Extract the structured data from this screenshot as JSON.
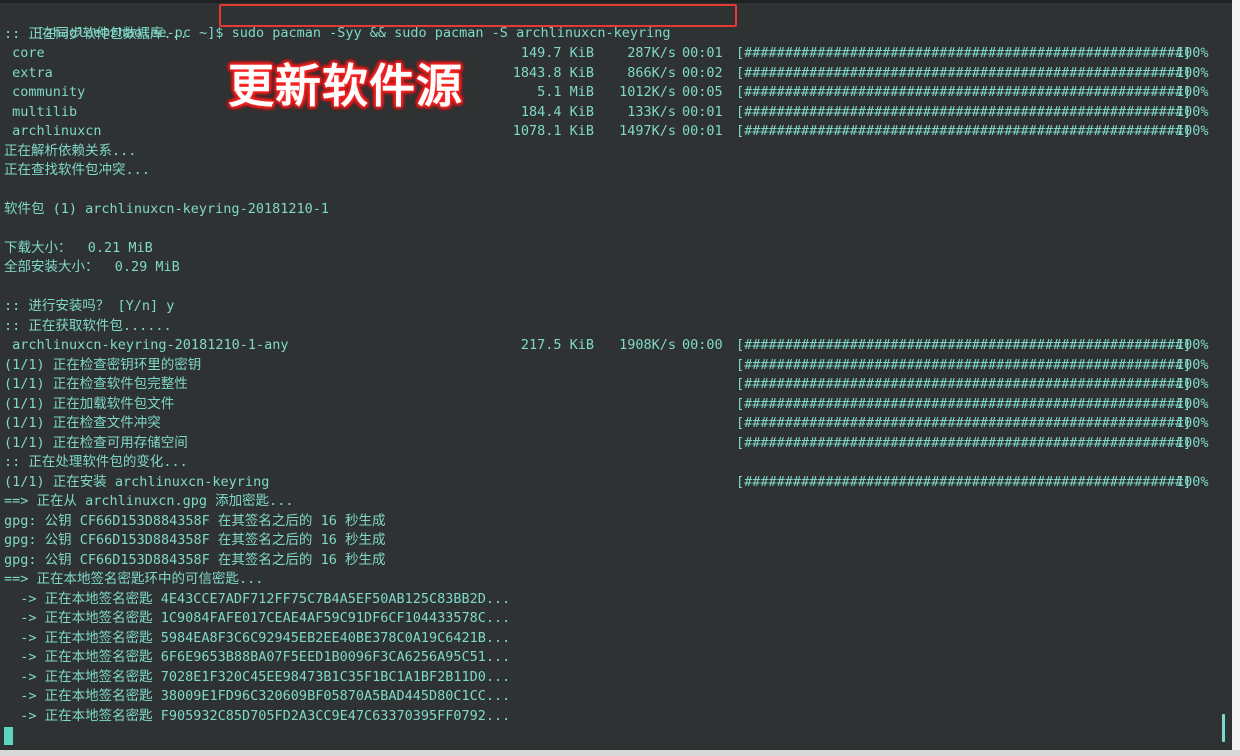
{
  "terminal": {
    "prompt": "[zhaolee@zhaolee-pc ~]$ ",
    "command": "sudo pacman -Syy && sudo pacman -S archlinuxcn-keyring",
    "sync_msg": ":: 正在同步软件包数据库...",
    "repos": [
      {
        "name": " core",
        "size": "149.7 KiB",
        "speed": "287K/s",
        "time": "00:01",
        "bar": "[######################################################]",
        "pct": "100%"
      },
      {
        "name": " extra",
        "size": "1843.8 KiB",
        "speed": "866K/s",
        "time": "00:02",
        "bar": "[######################################################]",
        "pct": "100%"
      },
      {
        "name": " community",
        "size": "5.1 MiB",
        "speed": "1012K/s",
        "time": "00:05",
        "bar": "[######################################################]",
        "pct": "100%"
      },
      {
        "name": " multilib",
        "size": "184.4 KiB",
        "speed": "133K/s",
        "time": "00:01",
        "bar": "[######################################################]",
        "pct": "100%"
      },
      {
        "name": " archlinuxcn",
        "size": "1078.1 KiB",
        "speed": "1497K/s",
        "time": "00:01",
        "bar": "[######################################################]",
        "pct": "100%"
      }
    ],
    "resolving": "正在解析依赖关系...",
    "conflicts": "正在查找软件包冲突...",
    "package_line": "软件包 (1) archlinuxcn-keyring-20181210-1",
    "download_size": "下载大小：  0.21 MiB",
    "install_size": "全部安装大小：  0.29 MiB",
    "confirm": ":: 进行安装吗？ [Y/n] y",
    "fetching": ":: 正在获取软件包......",
    "fetch": {
      "name": " archlinuxcn-keyring-20181210-1-any",
      "size": "217.5 KiB",
      "speed": "1908K/s",
      "time": "00:00",
      "bar": "[######################################################]",
      "pct": "100%"
    },
    "checks": [
      {
        "text": "(1/1) 正在检查密钥环里的密钥",
        "bar": "[######################################################]",
        "pct": "100%"
      },
      {
        "text": "(1/1) 正在检查软件包完整性",
        "bar": "[######################################################]",
        "pct": "100%"
      },
      {
        "text": "(1/1) 正在加载软件包文件",
        "bar": "[######################################################]",
        "pct": "100%"
      },
      {
        "text": "(1/1) 正在检查文件冲突",
        "bar": "[######################################################]",
        "pct": "100%"
      },
      {
        "text": "(1/1) 正在检查可用存储空间",
        "bar": "[######################################################]",
        "pct": "100%"
      }
    ],
    "processing": ":: 正在处理软件包的变化...",
    "installing": {
      "text": "(1/1) 正在安装 archlinuxcn-keyring",
      "bar": "[######################################################]",
      "pct": "100%"
    },
    "adding_keys": "==> 正在从 archlinuxcn.gpg 添加密匙...",
    "gpg_lines": [
      "gpg: 公钥 CF66D153D884358F 在其签名之后的 16 秒生成",
      "gpg: 公钥 CF66D153D884358F 在其签名之后的 16 秒生成",
      "gpg: 公钥 CF66D153D884358F 在其签名之后的 16 秒生成"
    ],
    "local_sign": "==> 正在本地签名密匙环中的可信密匙...",
    "sign_lines": [
      "  -> 正在本地签名密匙 4E43CCE7ADF712FF75C7B4A5EF50AB125C83BB2D...",
      "  -> 正在本地签名密匙 1C9084FAFE017CEAE4AF59C91DF6CF104433578C...",
      "  -> 正在本地签名密匙 5984EA8F3C6C92945EB2EE40BE378C0A19C6421B...",
      "  -> 正在本地签名密匙 6F6E9653B88BA07F5EED1B0096F3CA6256A95C51...",
      "  -> 正在本地签名密匙 7028E1F320C45EE98473B1C35F1BC1A1BF2B11D0...",
      "  -> 正在本地签名密匙 38009E1FD96C320609BF05870A5BAD445D80C1CC...",
      "  -> 正在本地签名密匙 F905932C85D705FD2A3CC9E47C63370395FF0792..."
    ]
  },
  "annotation": {
    "overlay_text": "更新软件源",
    "highlight_color": "#e53935"
  }
}
